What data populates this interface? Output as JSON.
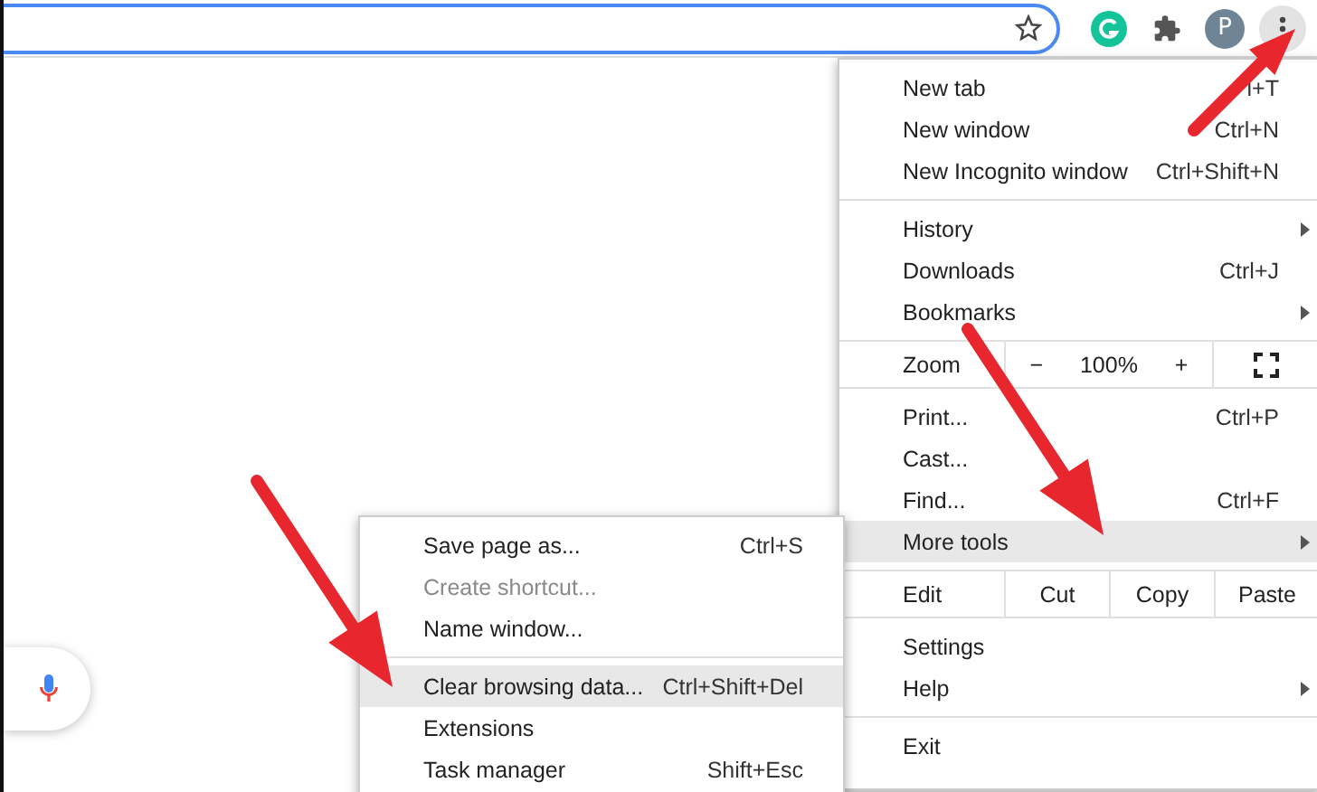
{
  "toolbar": {
    "avatar_letter": "P"
  },
  "menu": {
    "items": [
      {
        "kind": "item",
        "label": "New tab",
        "shortcut": "l+T",
        "has_submenu": false,
        "selected": false
      },
      {
        "kind": "item",
        "label": "New window",
        "shortcut": "Ctrl+N",
        "has_submenu": false,
        "selected": false
      },
      {
        "kind": "item",
        "label": "New Incognito window",
        "shortcut": "Ctrl+Shift+N",
        "has_submenu": false,
        "selected": false
      },
      {
        "kind": "separator"
      },
      {
        "kind": "item",
        "label": "History",
        "has_submenu": true,
        "selected": false
      },
      {
        "kind": "item",
        "label": "Downloads",
        "shortcut": "Ctrl+J",
        "has_submenu": false,
        "selected": false
      },
      {
        "kind": "item",
        "label": "Bookmarks",
        "has_submenu": true,
        "selected": false
      },
      {
        "kind": "zoom",
        "label": "Zoom",
        "minus": "−",
        "value": "100%",
        "plus": "+"
      },
      {
        "kind": "item",
        "label": "Print...",
        "shortcut": "Ctrl+P",
        "has_submenu": false,
        "selected": false
      },
      {
        "kind": "item",
        "label": "Cast...",
        "has_submenu": false,
        "selected": false
      },
      {
        "kind": "item",
        "label": "Find...",
        "shortcut": "Ctrl+F",
        "has_submenu": false,
        "selected": false
      },
      {
        "kind": "item",
        "label": "More tools",
        "has_submenu": true,
        "selected": true
      },
      {
        "kind": "edit",
        "label": "Edit",
        "buttons": [
          "Cut",
          "Copy",
          "Paste"
        ]
      },
      {
        "kind": "item",
        "label": "Settings",
        "has_submenu": false,
        "selected": false
      },
      {
        "kind": "item",
        "label": "Help",
        "has_submenu": true,
        "selected": false
      },
      {
        "kind": "separator"
      },
      {
        "kind": "item",
        "label": "Exit",
        "has_submenu": false,
        "selected": false
      }
    ]
  },
  "submenu": {
    "items": [
      {
        "kind": "item",
        "label": "Save page as...",
        "shortcut": "Ctrl+S",
        "disabled": false,
        "selected": false
      },
      {
        "kind": "item",
        "label": "Create shortcut...",
        "disabled": true,
        "selected": false
      },
      {
        "kind": "item",
        "label": "Name window...",
        "disabled": false,
        "selected": false
      },
      {
        "kind": "separator"
      },
      {
        "kind": "item",
        "label": "Clear browsing data...",
        "shortcut": "Ctrl+Shift+Del",
        "disabled": false,
        "selected": true
      },
      {
        "kind": "item",
        "label": "Extensions",
        "disabled": false,
        "selected": false
      },
      {
        "kind": "item",
        "label": "Task manager",
        "shortcut": "Shift+Esc",
        "disabled": false,
        "selected": false
      }
    ]
  }
}
